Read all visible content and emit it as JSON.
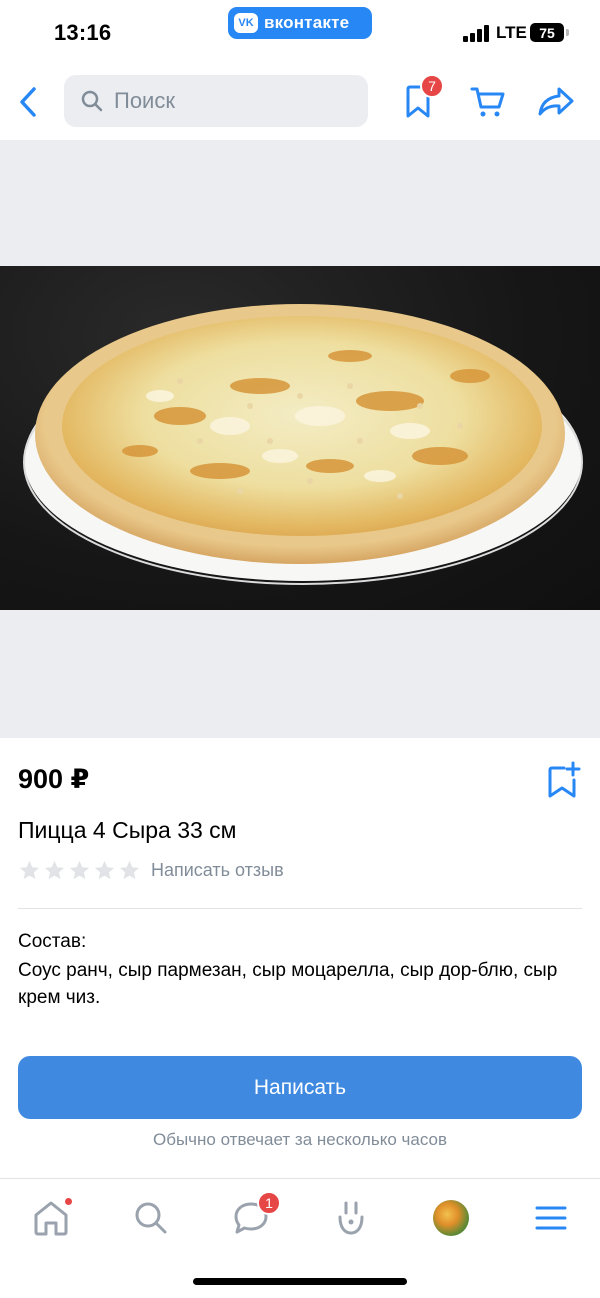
{
  "status_bar": {
    "time": "13:16",
    "app_pill": "вконтакте",
    "app_logo": "VK",
    "network": "LTE",
    "battery": "75"
  },
  "header": {
    "search_placeholder": "Поиск",
    "bookmarks_badge": "7"
  },
  "product": {
    "price": "900 ₽",
    "title": "Пицца 4 Сыра 33 см",
    "rating_stars": 0,
    "review_link": "Написать отзыв",
    "composition_label": "Состав:",
    "composition_text": "Соус ранч, сыр пармезан, сыр моцарелла, сыр дор-блю, сыр крем чиз."
  },
  "actions": {
    "write_button": "Написать",
    "reply_note": "Обычно отвечает за несколько часов"
  },
  "tabbar": {
    "messages_badge": "1"
  },
  "colors": {
    "accent": "#2787F5",
    "button": "#3F8AE0",
    "badge": "#E64646",
    "secondary_text": "#818C99",
    "gallery_bg": "#EBEDF0"
  }
}
